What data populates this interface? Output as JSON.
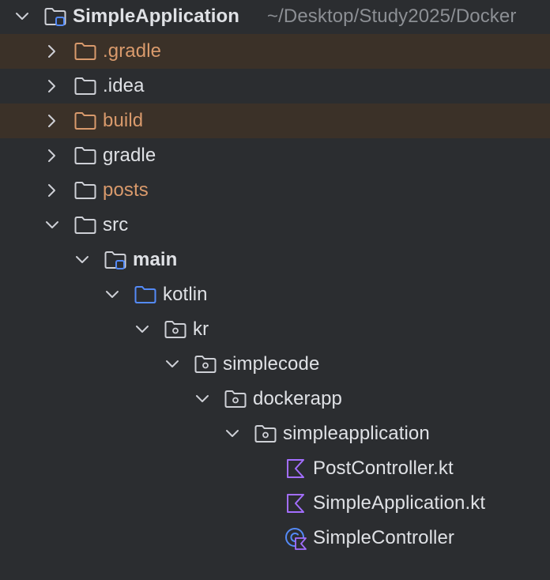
{
  "project": {
    "name": "SimpleApplication",
    "path": "~/Desktop/Study2025/Docker"
  },
  "nodes": [
    {
      "label": "SimpleApplication",
      "icon": "module-folder-icon",
      "expanded": true,
      "excluded": false
    },
    {
      "label": ".gradle",
      "icon": "folder-icon",
      "expanded": false,
      "excluded": true
    },
    {
      "label": ".idea",
      "icon": "folder-icon",
      "expanded": false,
      "excluded": false
    },
    {
      "label": "build",
      "icon": "folder-icon",
      "expanded": false,
      "excluded": true
    },
    {
      "label": "gradle",
      "icon": "folder-icon",
      "expanded": false,
      "excluded": false
    },
    {
      "label": "posts",
      "icon": "folder-icon",
      "expanded": false,
      "excluded": false
    },
    {
      "label": "src",
      "icon": "folder-icon",
      "expanded": true,
      "excluded": false
    },
    {
      "label": "main",
      "icon": "module-folder-icon",
      "expanded": true,
      "excluded": false
    },
    {
      "label": "kotlin",
      "icon": "source-root-folder-icon",
      "expanded": true,
      "excluded": false
    },
    {
      "label": "kr",
      "icon": "package-icon",
      "expanded": true,
      "excluded": false
    },
    {
      "label": "simplecode",
      "icon": "package-icon",
      "expanded": true,
      "excluded": false
    },
    {
      "label": "dockerapp",
      "icon": "package-icon",
      "expanded": true,
      "excluded": false
    },
    {
      "label": "simpleapplication",
      "icon": "package-icon",
      "expanded": true,
      "excluded": false
    },
    {
      "label": "PostController.kt",
      "icon": "kotlin-file-icon",
      "excluded": false
    },
    {
      "label": "SimpleApplication.kt",
      "icon": "kotlin-file-icon",
      "excluded": false
    },
    {
      "label": "SimpleController",
      "icon": "kotlin-class-icon",
      "excluded": false
    }
  ],
  "colors": {
    "background": "#2b2d30",
    "excluded_row": "#3b3128",
    "excluded_text": "#d99a6c",
    "text": "#dfe1e5",
    "path_text": "#8c8f94",
    "folder_outline": "#ced0d6",
    "excluded_folder": "#d99a6c",
    "source_root": "#548af7",
    "kotlin": "#a36eff"
  }
}
